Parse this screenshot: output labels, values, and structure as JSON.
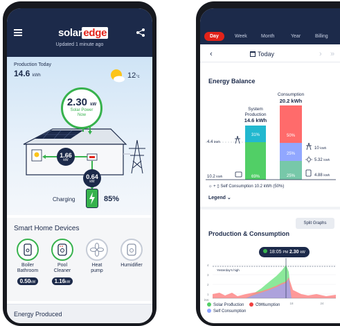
{
  "colors": {
    "navy": "#1c2a4a",
    "brand_red": "#e2231a",
    "solar_green": "#37b24d",
    "consumption_red": "#f03e3e",
    "self_consumption_blue": "#91a7ff",
    "system_teal": "#22b8cf"
  },
  "left_screen": {
    "header": {
      "menu_icon": "hamburger-icon",
      "logo_part1": "solar",
      "logo_part2": "edge",
      "share_icon": "share-icon",
      "updated": "Updated 1 minute ago"
    },
    "production_today": {
      "label": "Production Today",
      "value": "14.6",
      "unit": "kWh"
    },
    "weather": {
      "icon": "partly-sunny-icon",
      "temp": "12",
      "unit": "°c"
    },
    "solar_power": {
      "value": "2.30",
      "unit": "kW",
      "label_line1": "Solar Power",
      "label_line2": "Now"
    },
    "flows": {
      "house_to_load": {
        "value": "1.66",
        "unit": "kW"
      },
      "to_battery": {
        "value": "0.64",
        "unit": "kW"
      }
    },
    "battery": {
      "label": "Charging",
      "percent": "85%",
      "level": 0.85
    },
    "smart_home": {
      "title": "Smart Home Devices",
      "devices": [
        {
          "name_line1": "Boiler",
          "name_line2": "Bathroom",
          "power": "0.50",
          "unit": "kW",
          "active": true
        },
        {
          "name_line1": "Pool",
          "name_line2": "Cleaner",
          "power": "1.16",
          "unit": "kW",
          "active": true
        },
        {
          "name_line1": "Heat",
          "name_line2": "pump",
          "power": "",
          "unit": "",
          "active": false
        },
        {
          "name_line1": "Humidifier",
          "name_line2": "",
          "power": "",
          "unit": "",
          "active": false
        }
      ]
    },
    "energy_produced": {
      "title": "Energy Produced"
    }
  },
  "right_screen": {
    "tabs": [
      "Day",
      "Week",
      "Month",
      "Year",
      "Billing"
    ],
    "active_tab": "Day",
    "date_title": "Today",
    "energy_balance": {
      "title": "Energy Balance",
      "consumption_label": "Consumption",
      "consumption_value": "20.2 kWh",
      "system_production_line1": "System",
      "system_production_line2": "Production",
      "system_production_value": "14.6 kWh",
      "production_segments": [
        {
          "label": "31%",
          "percent": 31
        },
        {
          "label": "69%",
          "percent": 69
        }
      ],
      "consumption_segments": [
        {
          "label": "50%",
          "percent": 50
        },
        {
          "label": "25%",
          "percent": 25
        },
        {
          "label": "25%",
          "percent": 25
        }
      ],
      "left_values": [
        {
          "value": "4.4",
          "unit": "kWh",
          "icon": "grid-tower-icon"
        },
        {
          "value": "10.2",
          "unit": "kWh",
          "icon": "battery-icon"
        }
      ],
      "right_values": [
        {
          "value": "10",
          "unit": "kWh",
          "icon": "grid-tower-icon"
        },
        {
          "value": "5.32",
          "unit": "kWh",
          "icon": "sun-icon"
        },
        {
          "value": "4.88",
          "unit": "kWh",
          "icon": "battery-icon"
        }
      ],
      "self_consumption": "Self Consumption 10.2 kWh (50%)",
      "legend_link": "Legend"
    },
    "production_consumption": {
      "split_button": "Split Graphs",
      "title": "Production & Consumption",
      "tooltip": {
        "time": "18:05",
        "ampm": "PM",
        "value": "2.30",
        "unit": "kW"
      },
      "yesterday_label": "Yesterday's high",
      "y_ticks": [
        "4",
        "3",
        "2",
        "1"
      ],
      "y_unit": "kW",
      "x_ticks": [
        "6",
        "Noon",
        "18",
        "24"
      ],
      "legend": [
        "Solar Production",
        "Consumption",
        "Self Consumption"
      ]
    }
  }
}
